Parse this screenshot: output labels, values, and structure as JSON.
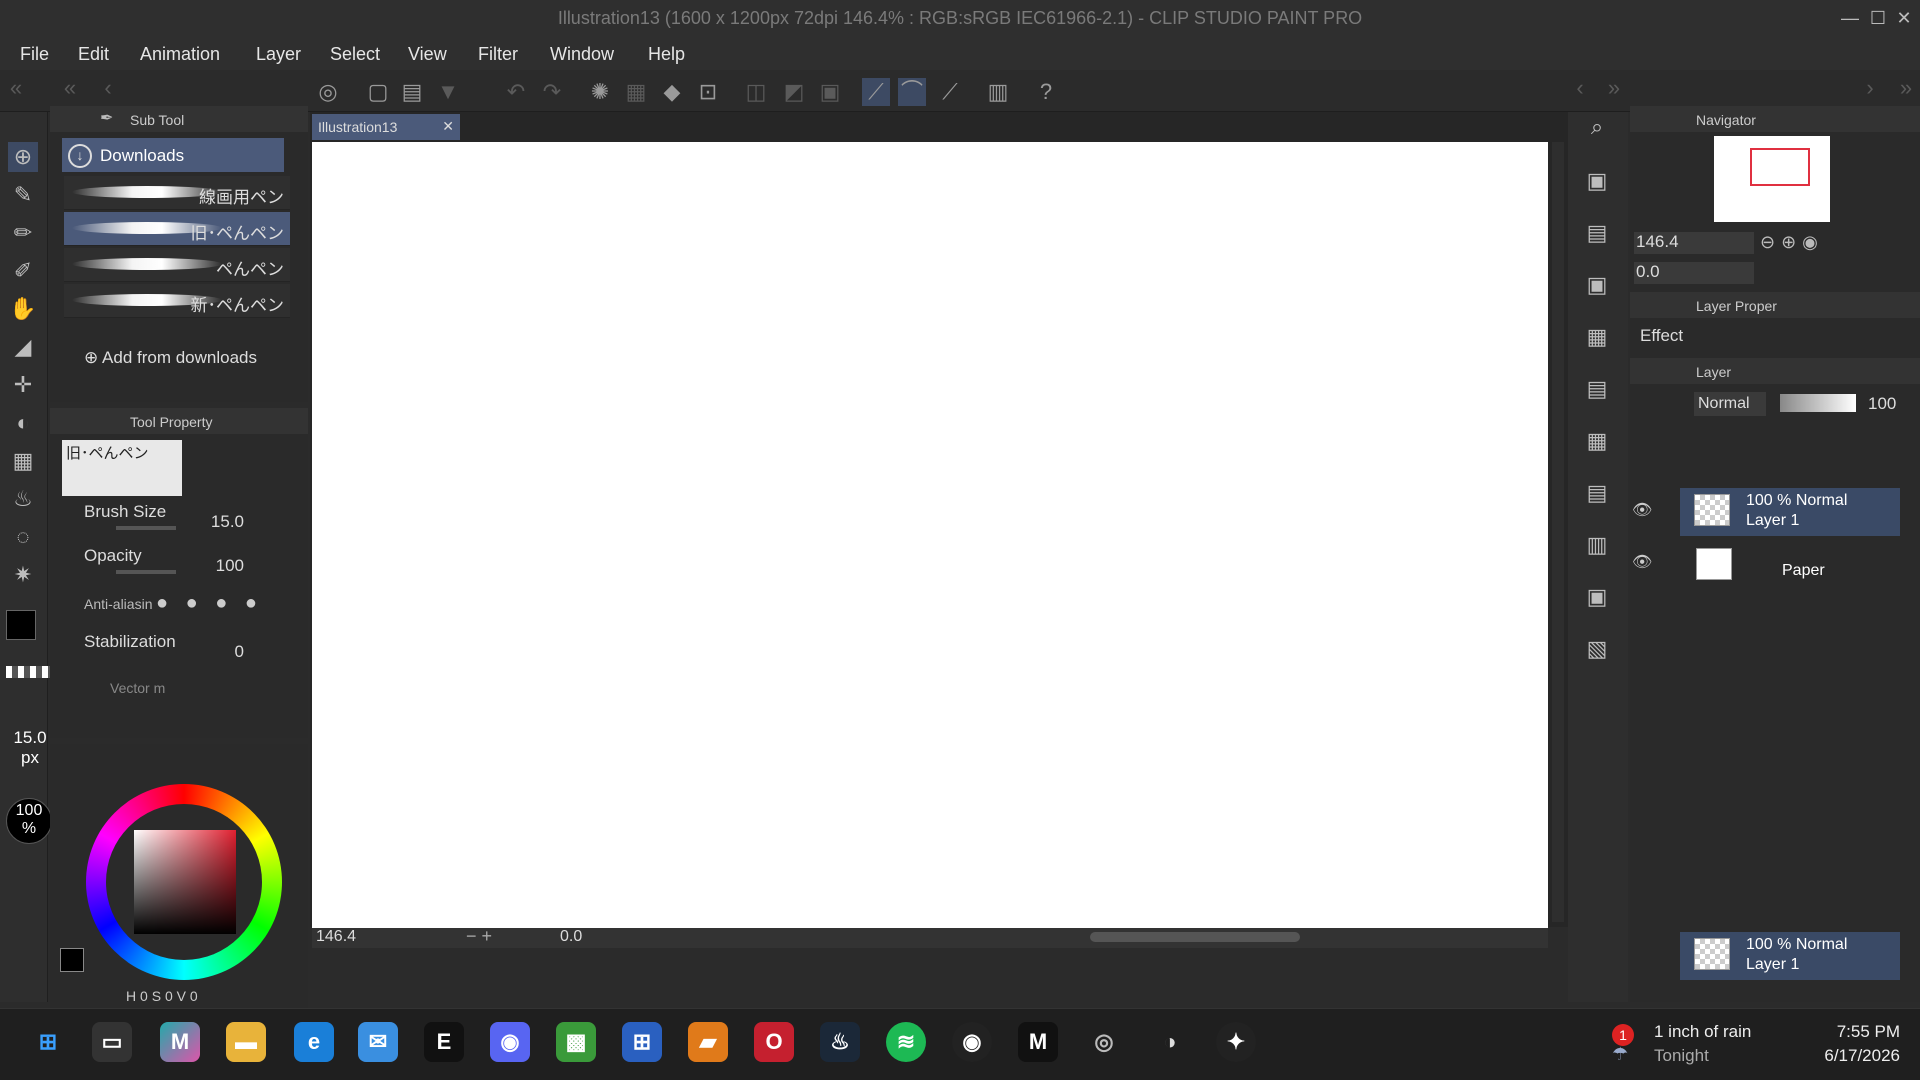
{
  "title": "Illustration13 (1600 x 1200px 72dpi 146.4% : RGB:sRGB IEC61966-2.1) - CLIP STUDIO PAINT PRO",
  "menu": [
    "File",
    "Edit",
    "Animation",
    "Layer",
    "Select",
    "View",
    "Filter",
    "Window",
    "Help"
  ],
  "subtool": {
    "header": "Sub Tool",
    "group": "Downloads",
    "brushes": [
      "線画用ペン",
      "旧･ペんペン",
      "ペんペン",
      "新･ペんペン"
    ],
    "add_label": "Add from downloads"
  },
  "toolprop": {
    "header": "Tool Property",
    "preset_name": "旧･ペんペン",
    "brush_size_label": "Brush Size",
    "brush_size": "15.0",
    "opacity_label": "Opacity",
    "opacity": "100",
    "antialias_label": "Anti-aliasin",
    "stabilization_label": "Stabilization",
    "stabilization": "0",
    "vector_label": "Vector m"
  },
  "left_indicators": {
    "size": "15.0",
    "size_unit": "px",
    "opacity": "100",
    "opacity_unit": "%"
  },
  "color_values": [
    "H",
    "0",
    "S",
    "0",
    "V",
    "0"
  ],
  "document": {
    "tab": "Illustration13",
    "zoom": "146.4",
    "rotation": "0.0"
  },
  "navigator": {
    "header": "Navigator",
    "zoom": "146.4",
    "rotation": "0.0"
  },
  "layer_property": {
    "header": "Layer Proper",
    "effect": "Effect"
  },
  "layer_panel": {
    "header": "Layer",
    "blend": "Normal",
    "opacity": "100",
    "layers": [
      {
        "mode": "100 % Normal",
        "name": "Layer 1"
      },
      {
        "mode": "",
        "name": "Paper"
      }
    ],
    "bottom_layer": {
      "mode": "100 % Normal",
      "name": "Layer 1"
    }
  },
  "taskbar": {
    "weather_badge": "1",
    "weather_line1": "1 inch of rain",
    "weather_line2": "Tonight",
    "time": "7:55 PM",
    "date": "6/17/2026",
    "apps": [
      "windows-start",
      "file-app",
      "m365",
      "file-explorer",
      "edge",
      "outlook",
      "epic-games",
      "discord",
      "minecraft",
      "store",
      "slides",
      "opera",
      "steam",
      "spotify",
      "obs",
      "mail",
      "clip-studio",
      "clip-studio-2",
      "davinci"
    ]
  }
}
